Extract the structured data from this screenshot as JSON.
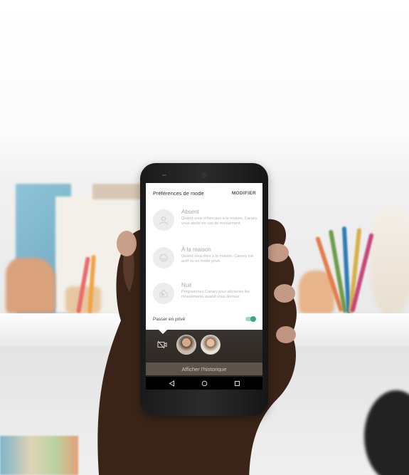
{
  "card": {
    "title": "Préférences de mode",
    "edit_label": "MODIFIER",
    "modes": [
      {
        "title": "Absent",
        "description": "Quand vous n'êtes pas à la maison, Canary vous alerte en cas de mouvement.",
        "icon": "person-away-icon"
      },
      {
        "title": "À la maison",
        "description": "Quand vous êtes à la maison, Canary est actif ou en mode privé.",
        "icon": "smile-face-icon"
      },
      {
        "title": "Nuit",
        "description": "Programmez Canary pour déctecter les mouvements quand vous dormez.",
        "icon": "house-moon-icon"
      }
    ],
    "private_label": "Passer en privé",
    "private_enabled": true
  },
  "history_label": "Afficher l'historique",
  "colors": {
    "toggle_accent": "#3aa77f"
  }
}
